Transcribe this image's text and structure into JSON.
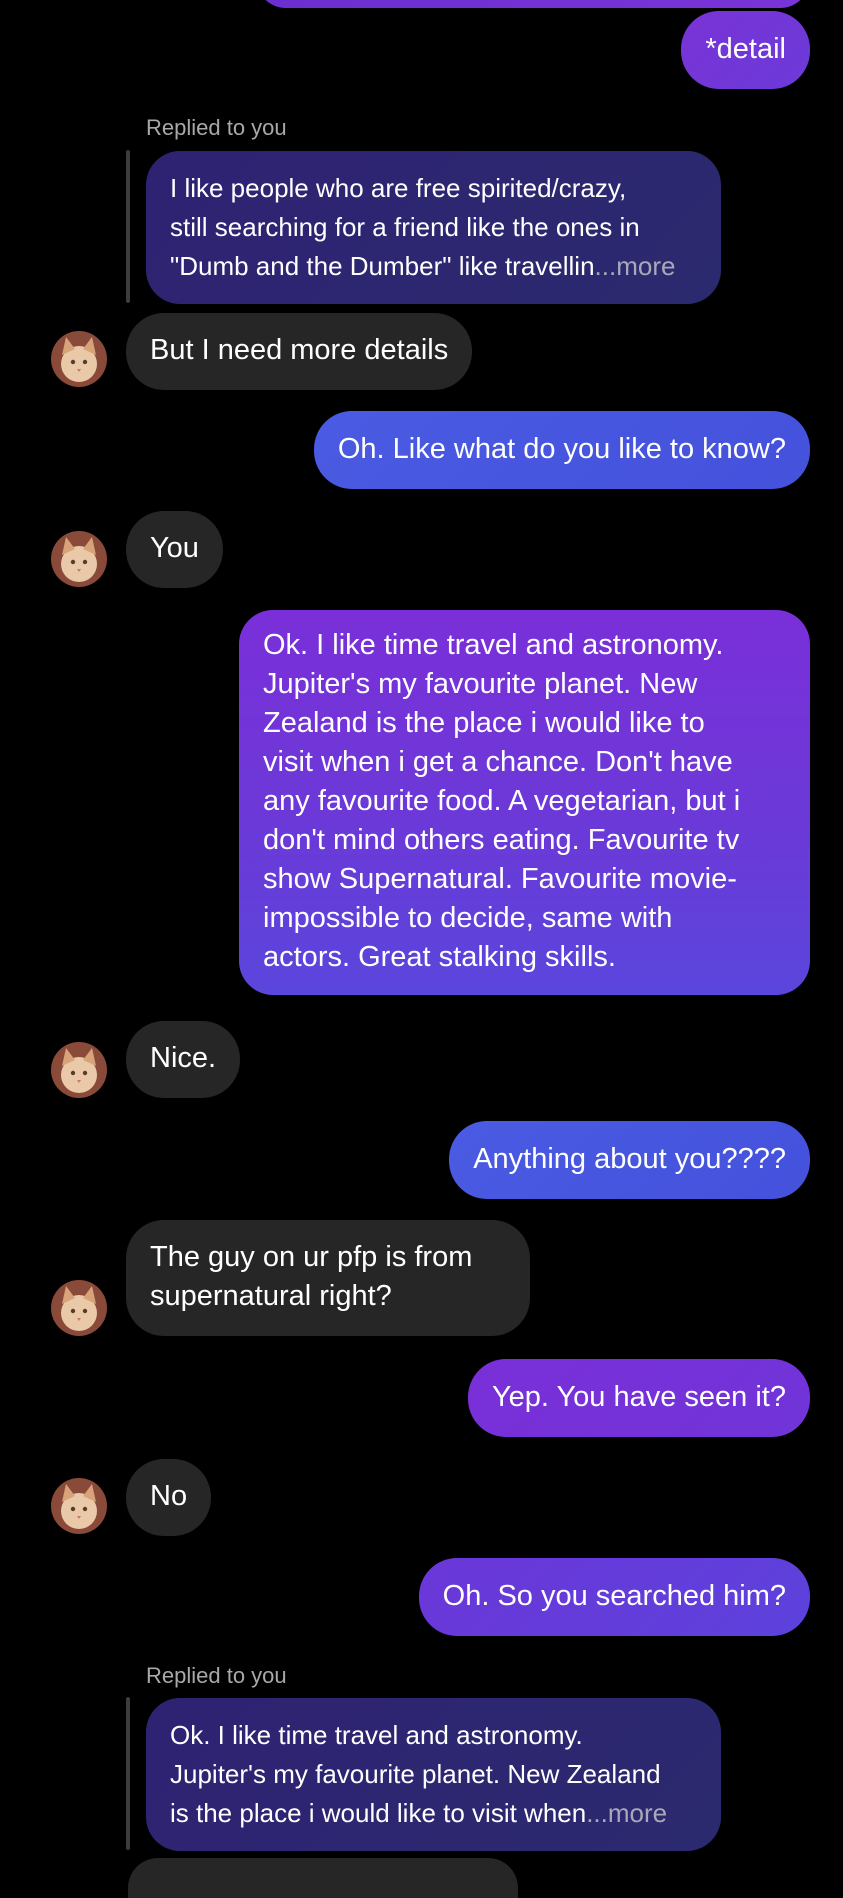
{
  "colors": {
    "background": "#000000",
    "received_bubble": "#262626",
    "sent_blue": "#4a5ae0",
    "sent_purple": "#7a2fd8",
    "quote_bubble": "#2d2470",
    "reply_label": "#a8a8a8"
  },
  "icons": {
    "avatar": "cat-avatar-icon"
  },
  "messages": [
    {
      "id": "m1",
      "type": "sent",
      "text": "*detail"
    },
    {
      "id": "m2",
      "type": "reply_quote",
      "label": "Replied to you",
      "quote_text": "I like people who are free spirited/crazy,\nstill searching for a friend like the ones in\n\"Dumb and the Dumber\"  like travellin",
      "more": "...more"
    },
    {
      "id": "m3",
      "type": "received",
      "text": "But I need more details"
    },
    {
      "id": "m4",
      "type": "sent",
      "text": "Oh. Like what do you like to know?"
    },
    {
      "id": "m5",
      "type": "received",
      "text": "You"
    },
    {
      "id": "m6",
      "type": "sent",
      "text": "Ok. I like time travel and astronomy.\nJupiter's my favourite planet. New\nZealand is the place i would like to\nvisit when i get a chance. Don't have\nany favourite food. A vegetarian, but i\ndon't mind others eating. Favourite tv\nshow Supernatural. Favourite movie-\nimpossible to decide, same with\nactors. Great stalking skills."
    },
    {
      "id": "m7",
      "type": "received",
      "text": "Nice."
    },
    {
      "id": "m8",
      "type": "sent",
      "text": "Anything about you????"
    },
    {
      "id": "m9",
      "type": "received",
      "text": "The guy on ur pfp is from\nsupernatural right?"
    },
    {
      "id": "m10",
      "type": "sent",
      "text": "Yep. You have seen it?"
    },
    {
      "id": "m11",
      "type": "received",
      "text": "No"
    },
    {
      "id": "m12",
      "type": "sent",
      "text": "Oh. So you searched him?"
    },
    {
      "id": "m13",
      "type": "reply_quote",
      "label": "Replied to you",
      "quote_text": "Ok. I like time travel and astronomy.\nJupiter's my favourite planet. New Zealand\nis the place i would like to visit when",
      "more": "...more"
    }
  ]
}
